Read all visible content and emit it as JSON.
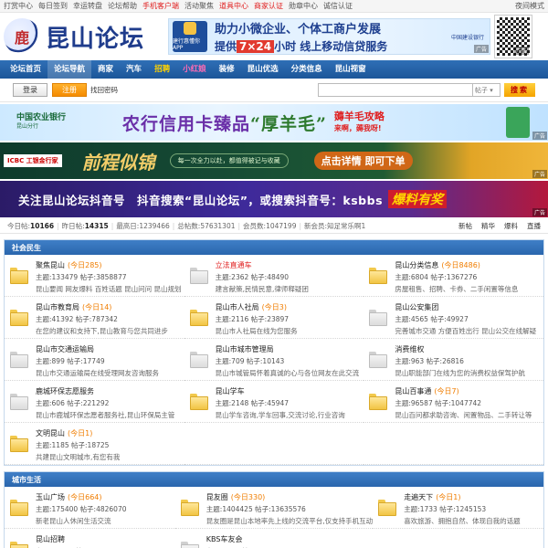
{
  "topbar": {
    "links": [
      {
        "label": "打赏中心",
        "red": false
      },
      {
        "label": "每日签到",
        "red": false
      },
      {
        "label": "幸运转盘",
        "red": false
      },
      {
        "label": "论坛帮助",
        "red": false
      },
      {
        "label": "手机客户端",
        "red": true
      },
      {
        "label": "活动聚焦",
        "red": false
      },
      {
        "label": "道具中心",
        "red": true
      },
      {
        "label": "商家认证",
        "red": true
      },
      {
        "label": "勋章中心",
        "red": false
      },
      {
        "label": "诚信认证",
        "red": false
      }
    ],
    "right": "夜间模式"
  },
  "header": {
    "logo_mark": "鹿",
    "logo_text": "昆山论坛",
    "ad": {
      "app_label": "建行惠懂你APP",
      "line1": "助力小微企业、个体工商户发展",
      "line2_prefix": "提供",
      "line2_highlight": "7×24",
      "line2_suffix": "小时 线上移动信贷服务",
      "bank": "中国建设银行",
      "tag": "广告"
    },
    "qr_tag": "广告"
  },
  "nav": [
    {
      "label": "论坛首页",
      "style": ""
    },
    {
      "label": "论坛导航",
      "style": "active"
    },
    {
      "label": "商家",
      "style": ""
    },
    {
      "label": "汽车",
      "style": ""
    },
    {
      "label": "招聘",
      "style": "hot"
    },
    {
      "label": "小红娘",
      "style": "pink"
    },
    {
      "label": "装修",
      "style": ""
    },
    {
      "label": "昆山优选",
      "style": ""
    },
    {
      "label": "分类信息",
      "style": ""
    },
    {
      "label": "昆山视窗",
      "style": ""
    }
  ],
  "login": {
    "login_label": "登录",
    "register_label": "注册",
    "find_password": "找回密码",
    "search_type": "帖子",
    "search_button": "搜索"
  },
  "banners": {
    "b1": {
      "bank": "中国农业银行",
      "bank_sub": "昆山分行",
      "main_a": "农行信用卡臻品",
      "main_b": "“厚羊毛”",
      "tip1": "薅羊毛攻略",
      "tip2": "来啊，薅我呀!",
      "tag": "广告"
    },
    "b2": {
      "bank": "ICBC 工银金行家",
      "title": "前程似锦",
      "slogan": "每一次全力以赴，都值得被记与收藏",
      "cta": "点击详情 即可下单",
      "tag": "广告"
    },
    "b3": {
      "text": "关注昆山论坛抖音号　抖音搜索“昆山论坛”，或搜索抖音号：ksbbs",
      "badge": "爆料有奖",
      "tag": "广告"
    }
  },
  "stats": {
    "today_label": "今日帖:",
    "today": "10166",
    "yesterday_label": "昨日帖:",
    "yesterday": "14315",
    "max_label": "最高日:",
    "max": "1239466",
    "total_label": "总帖数:",
    "total": "57631301",
    "members_label": "会员数:",
    "members": "1047199",
    "newest_label": "新会员:",
    "newest": "知足常乐啊1",
    "links": [
      "新帖",
      "精华",
      "爆料",
      "直播"
    ]
  },
  "sections": [
    {
      "title": "社会民生",
      "forums": [
        {
          "name": "聚焦昆山",
          "today": "(今日285)",
          "topics": "主题:133479",
          "posts": "帖子:3858877",
          "desc": "昆山要闻 网友爆料 百姓话题 昆山问问 昆山规划",
          "red": false,
          "grey": false
        },
        {
          "name": "立法直通车",
          "today": "",
          "topics": "主题:2362",
          "posts": "帖子:48490",
          "desc": "建言献策,民情民意,律师释疑团",
          "red": true,
          "grey": true
        },
        {
          "name": "昆山分类信息",
          "today": "(今日8486)",
          "topics": "主题:6804",
          "posts": "帖子:1367276",
          "desc": "房屋租售、招聘、卡券、二手闲置等信息",
          "red": false,
          "grey": false
        },
        {
          "name": "昆山市教育局",
          "today": "(今日14)",
          "topics": "主题:41392",
          "posts": "帖子:787342",
          "desc": "在您的建议和支持下,昆山教育与您共同进步",
          "red": false,
          "grey": false
        },
        {
          "name": "昆山市人社局",
          "today": "(今日3)",
          "topics": "主题:2116",
          "posts": "帖子:23897",
          "desc": "昆山市人社局在线为您服务",
          "red": false,
          "grey": false
        },
        {
          "name": "昆山公安集团",
          "today": "",
          "topics": "主题:4565",
          "posts": "帖子:49927",
          "desc": "完善城市交通 方便百姓出行 昆山公交在线解疑",
          "red": false,
          "grey": true
        },
        {
          "name": "昆山市交通运输局",
          "today": "",
          "topics": "主题:899",
          "posts": "帖子:17749",
          "desc": "昆山市交通运输局在线受理网友咨询服务",
          "red": false,
          "grey": true
        },
        {
          "name": "昆山市城市管理局",
          "today": "",
          "topics": "主题:709",
          "posts": "帖子:10143",
          "desc": "昆山市城管局怀着真诚的心与各位网友在此交流",
          "red": false,
          "grey": true
        },
        {
          "name": "消费维权",
          "today": "",
          "topics": "主题:963",
          "posts": "帖子:26816",
          "desc": "昆山职能部门在线为您的消费权益保驾护航",
          "red": false,
          "grey": true
        },
        {
          "name": "鹿城环保志愿服务",
          "today": "",
          "topics": "主题:606",
          "posts": "帖子:221292",
          "desc": "昆山市鹿城环保志愿者服务社,昆山环保局主管",
          "red": false,
          "grey": true
        },
        {
          "name": "昆山学车",
          "today": "",
          "topics": "主题:2148",
          "posts": "帖子:45947",
          "desc": "昆山学车咨询,学车回事,交流讨论,行业咨询",
          "red": false,
          "grey": false
        },
        {
          "name": "昆山百事通",
          "today": "(今日7)",
          "topics": "主题:96587",
          "posts": "帖子:1047742",
          "desc": "昆山百问都求助咨询、闲置物品、二手转让等",
          "red": false,
          "grey": false
        },
        {
          "name": "文明昆山",
          "today": "(今日1)",
          "topics": "主题:1185",
          "posts": "帖子:18725",
          "desc": "共建昆山文明城市,有您有我",
          "red": false,
          "grey": false
        }
      ]
    },
    {
      "title": "城市生活",
      "forums": [
        {
          "name": "玉山广场",
          "today": "(今日664)",
          "topics": "主题:175400",
          "posts": "帖子:4826070",
          "desc": "新老昆山人休闲生活交流",
          "red": false,
          "grey": false
        },
        {
          "name": "昆友圈",
          "today": "(今日330)",
          "topics": "主题:1404425",
          "posts": "帖子:13635576",
          "desc": "昆友圈是昆山本地率先上线的交流平台,仅支持手机互动",
          "red": false,
          "grey": false
        },
        {
          "name": "走遍天下",
          "today": "(今日1)",
          "topics": "主题:1733",
          "posts": "帖子:1245153",
          "desc": "喜欢旅游、拥抱自然、体现自我的话题",
          "red": false,
          "grey": false
        },
        {
          "name": "昆山招聘",
          "today": "",
          "topics": "主题:49923",
          "posts": "帖子:195039",
          "desc": "",
          "red": false,
          "grey": false
        },
        {
          "name": "KBS车友会",
          "today": "",
          "topics": "主题:5253",
          "posts": "帖子:88077",
          "desc": "",
          "red": false,
          "grey": true
        }
      ]
    }
  ]
}
